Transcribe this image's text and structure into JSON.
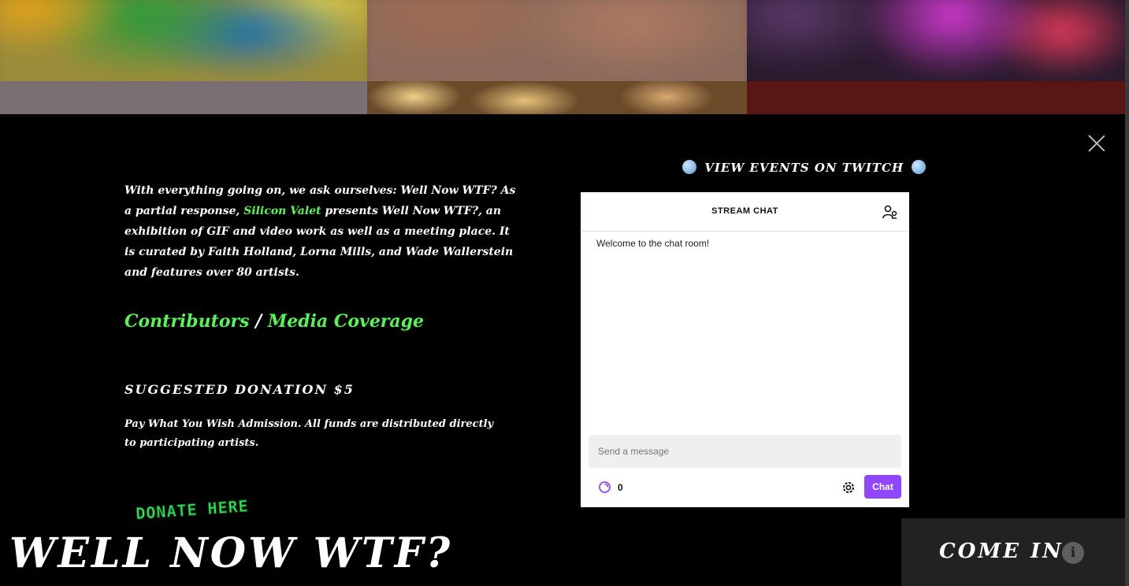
{
  "intro": {
    "part1": "With everything going on, we ask ourselves: Well Now WTF? As a partial response, ",
    "highlight": "Silicon Valet",
    "part2": " presents Well Now WTF?, an exhibition of GIF and video work as well as a meeting place. It is curated by Faith Holland, Lorna Mills, and Wade Wallerstein and features over 80 artists."
  },
  "links": {
    "contributors": "Contributors",
    "separator": " / ",
    "media": "Media Coverage"
  },
  "donation": {
    "heading": "SUGGESTED DONATION $5",
    "text": "Pay What You Wish Admission. All funds are distributed directly to participating artists.",
    "button_label": "DONATE HERE"
  },
  "twitch": {
    "label": "VIEW EVENTS ON TWITCH"
  },
  "chat": {
    "title": "STREAM CHAT",
    "welcome": "Welcome to the chat room!",
    "input_placeholder": "Send a message",
    "points": "0",
    "send_label": "Chat",
    "accent": "#9147ff"
  },
  "site_title": "WELL NOW WTF?",
  "come_in": {
    "label": "COME IN",
    "info": "i"
  },
  "colors": {
    "link_green": "#56f556",
    "background": "#000000"
  },
  "icons": [
    "close-icon",
    "globe-icon",
    "users-icon",
    "channel-points-icon",
    "settings-icon",
    "info-icon"
  ]
}
